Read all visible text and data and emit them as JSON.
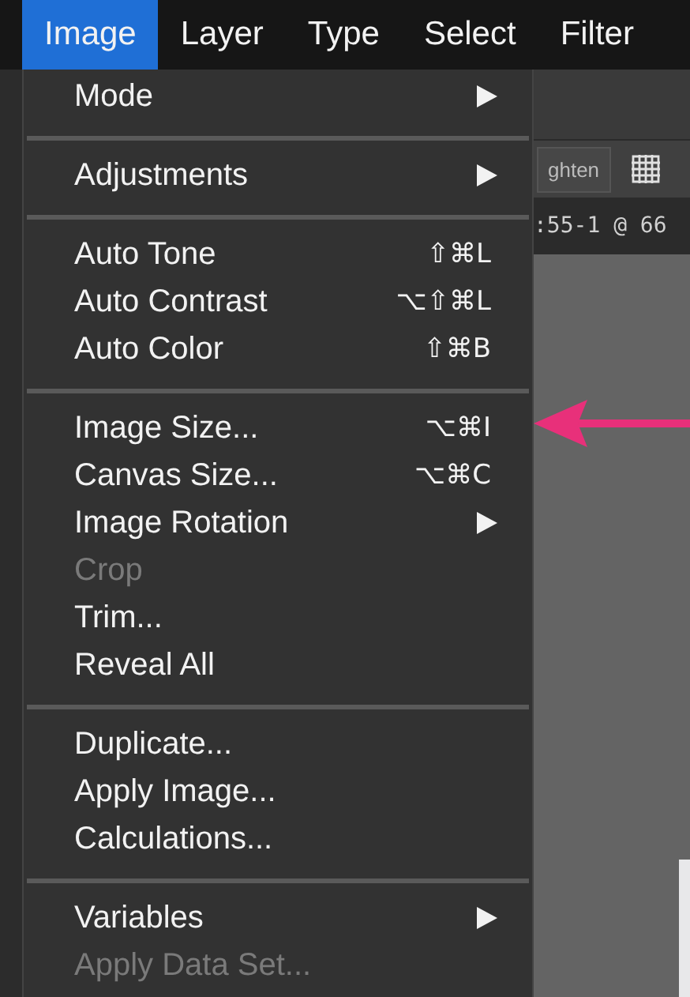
{
  "menubar": [
    {
      "label": "Image",
      "selected": true
    },
    {
      "label": "Layer",
      "selected": false
    },
    {
      "label": "Type",
      "selected": false
    },
    {
      "label": "Select",
      "selected": false
    },
    {
      "label": "Filter",
      "selected": false
    }
  ],
  "menu": {
    "groups": [
      [
        {
          "label": "Mode",
          "submenu": true,
          "disabled": false
        }
      ],
      [
        {
          "label": "Adjustments",
          "submenu": true,
          "disabled": false
        }
      ],
      [
        {
          "label": "Auto Tone",
          "shortcut": "⇧⌘L",
          "submenu": false,
          "disabled": false
        },
        {
          "label": "Auto Contrast",
          "shortcut": "⌥⇧⌘L",
          "submenu": false,
          "disabled": false
        },
        {
          "label": "Auto Color",
          "shortcut": "⇧⌘B",
          "submenu": false,
          "disabled": false
        }
      ],
      [
        {
          "label": "Image Size...",
          "shortcut": "⌥⌘I",
          "submenu": false,
          "disabled": false
        },
        {
          "label": "Canvas Size...",
          "shortcut": "⌥⌘C",
          "submenu": false,
          "disabled": false
        },
        {
          "label": "Image Rotation",
          "submenu": true,
          "disabled": false
        },
        {
          "label": "Crop",
          "submenu": false,
          "disabled": true
        },
        {
          "label": "Trim...",
          "submenu": false,
          "disabled": false
        },
        {
          "label": "Reveal All",
          "submenu": false,
          "disabled": false
        }
      ],
      [
        {
          "label": "Duplicate...",
          "submenu": false,
          "disabled": false
        },
        {
          "label": "Apply Image...",
          "submenu": false,
          "disabled": false
        },
        {
          "label": "Calculations...",
          "submenu": false,
          "disabled": false
        }
      ],
      [
        {
          "label": "Variables",
          "submenu": true,
          "disabled": false
        },
        {
          "label": "Apply Data Set...",
          "submenu": false,
          "disabled": true
        }
      ]
    ]
  },
  "options_bar": {
    "button": "ghten"
  },
  "document_tab": {
    "title": ":55-1 @ 66"
  }
}
